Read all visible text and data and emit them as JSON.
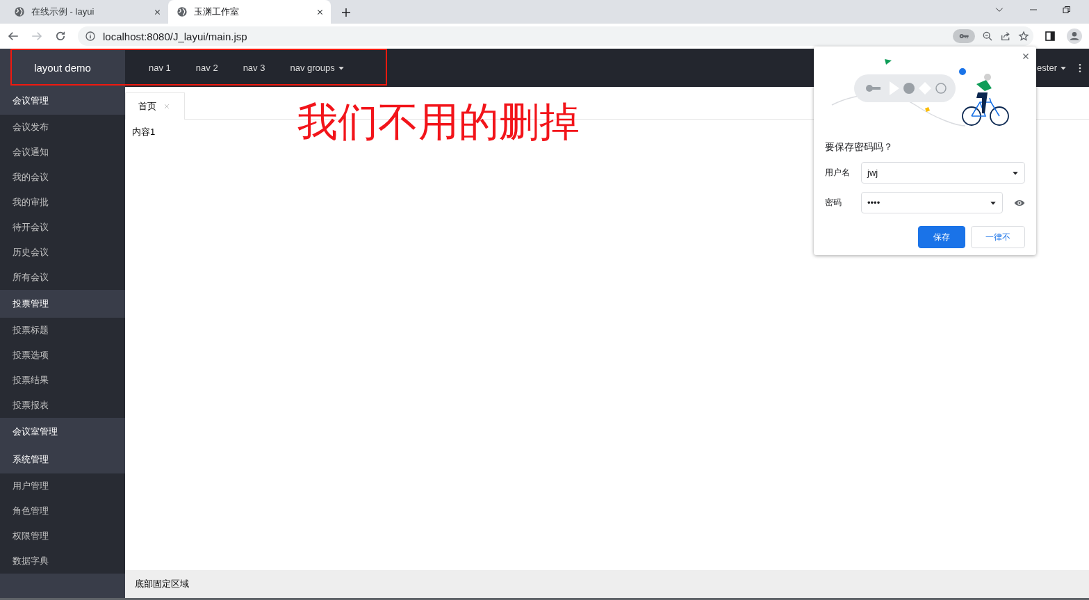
{
  "browser": {
    "tabs": [
      {
        "title": "在线示例 - layui",
        "selected": false
      },
      {
        "title": "玉渊工作室",
        "selected": true
      }
    ],
    "address": "localhost:8080/J_layui/main.jsp"
  },
  "header": {
    "logo": "layout demo",
    "nav": [
      {
        "label": "nav 1",
        "kind": "link"
      },
      {
        "label": "nav 2",
        "kind": "link"
      },
      {
        "label": "nav 3",
        "kind": "link"
      },
      {
        "label": "nav groups",
        "kind": "dropdown"
      }
    ],
    "user": "ester"
  },
  "annotation": "我们不用的删掉",
  "sidebar": {
    "groups": [
      {
        "label": "会议管理",
        "expanded": true,
        "children": [
          {
            "label": "会议发布"
          },
          {
            "label": "会议通知"
          },
          {
            "label": "我的会议"
          },
          {
            "label": "我的审批"
          },
          {
            "label": "待开会议"
          },
          {
            "label": "历史会议"
          },
          {
            "label": "所有会议"
          }
        ]
      },
      {
        "label": "投票管理",
        "expanded": true,
        "children": [
          {
            "label": "投票标题"
          },
          {
            "label": "投票选项"
          },
          {
            "label": "投票结果"
          },
          {
            "label": "投票报表"
          }
        ]
      },
      {
        "label": "会议室管理",
        "expanded": false
      },
      {
        "label": "系统管理",
        "expanded": true,
        "children": [
          {
            "label": "用户管理"
          },
          {
            "label": "角色管理"
          },
          {
            "label": "权限管理"
          },
          {
            "label": "数据字典"
          }
        ]
      }
    ]
  },
  "content": {
    "tabs": [
      {
        "label": "首页",
        "selected": true
      }
    ],
    "body": "内容1"
  },
  "footer": "底部固定区域",
  "password_dialog": {
    "title": "要保存密码吗？",
    "username_label": "用户名",
    "username": "jwj",
    "password_label": "密码",
    "password": "••••",
    "buttons": [
      {
        "label": "保存",
        "kind": "primary"
      },
      {
        "label": "一律不",
        "kind": "secondary"
      }
    ]
  }
}
